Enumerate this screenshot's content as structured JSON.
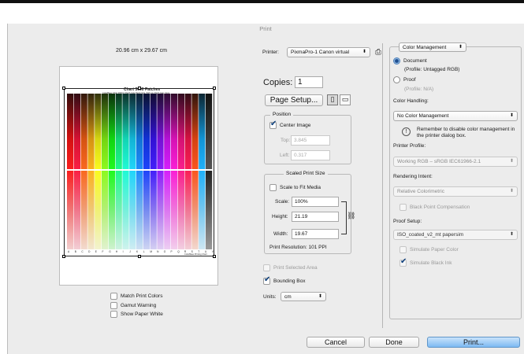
{
  "window": {
    "title": "Print"
  },
  "preview": {
    "size_label": "20.96 cm x 29.67 cm",
    "chart_title": "Chart 3000 Patches",
    "chart_subtitle": "ColorBase Chart 3000-0 Patch Cols  Patch Size: 8x8 mm  Patch Gap: 0mm",
    "column_letters": [
      "A",
      "B",
      "C",
      "D",
      "E",
      "F",
      "G",
      "H",
      "I",
      "J",
      "K",
      "L",
      "M",
      "N",
      "O",
      "P",
      "Q",
      "R",
      "S",
      "T",
      "U",
      "V"
    ],
    "footer_note": "ColorBase Printing Chart"
  },
  "options_left": {
    "match_print_colors": "Match Print Colors",
    "gamut_warning": "Gamut Warning",
    "show_paper_white": "Show Paper White"
  },
  "printer": {
    "label": "Printer:",
    "value": "PixmaPro-1 Canon virtual"
  },
  "copies": {
    "label": "Copies:",
    "value": "1"
  },
  "page_setup_button": "Page Setup...",
  "position": {
    "title": "Position",
    "center_image": "Center Image",
    "top_label": "Top:",
    "top_value": "3.845",
    "left_label": "Left:",
    "left_value": "0.317"
  },
  "scaled_print_size": {
    "title": "Scaled Print Size",
    "scale_to_fit": "Scale to Fit Media",
    "scale_label": "Scale:",
    "scale_value": "100%",
    "height_label": "Height:",
    "height_value": "21.19",
    "width_label": "Width:",
    "width_value": "19.67",
    "resolution": "Print Resolution: 101 PPI"
  },
  "print_selected_area": "Print Selected Area",
  "bounding_box": "Bounding Box",
  "units": {
    "label": "Units:",
    "value": "cm"
  },
  "color_management": {
    "section": "Color Management",
    "document": "Document",
    "document_profile": "(Profile: Untagged RGB)",
    "proof": "Proof",
    "proof_profile": "(Profile: N/A)",
    "color_handling_label": "Color Handling:",
    "color_handling_value": "No Color Management",
    "warning": "Remember to disable color management in the printer dialog box.",
    "printer_profile_label": "Printer Profile:",
    "printer_profile_value": "Working RGB – sRGB IEC61966-2.1",
    "rendering_intent_label": "Rendering Intent:",
    "rendering_intent_value": "Relative Colorimetric",
    "black_point": "Black Point Compensation",
    "proof_setup_label": "Proof Setup:",
    "proof_setup_value": "ISO_coated_v2_mt papersim",
    "simulate_paper": "Simulate Paper Color",
    "simulate_black": "Simulate Black Ink"
  },
  "buttons": {
    "cancel": "Cancel",
    "done": "Done",
    "print": "Print..."
  },
  "icons": {
    "printer_settings": "printer-icon",
    "portrait": "portrait-orientation-icon",
    "landscape": "landscape-orientation-icon",
    "link": "chain-link-icon",
    "warning": "exclamation-icon"
  },
  "colors": {
    "accent": "#7db9f2",
    "window_bg": "#ececec"
  }
}
